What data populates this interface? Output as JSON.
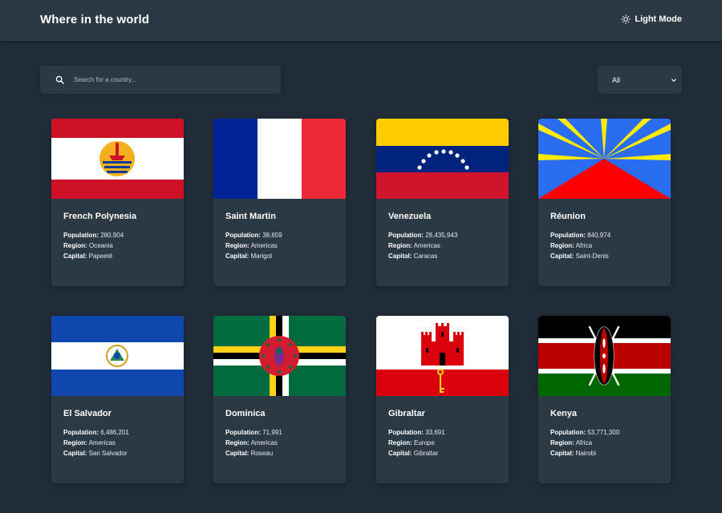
{
  "header": {
    "title": "Where in the world",
    "theme_label": "Light Mode"
  },
  "search": {
    "placeholder": "Search for a country..."
  },
  "filter": {
    "selected": "All"
  },
  "labels": {
    "population": "Population:",
    "region": "Region:",
    "capital": "Capital:"
  },
  "countries": [
    {
      "name": "French Polynesia",
      "population": "280,904",
      "region": "Oceania",
      "capital": "Papeeté"
    },
    {
      "name": "Saint Martin",
      "population": "38,659",
      "region": "Americas",
      "capital": "Marigot"
    },
    {
      "name": "Venezuela",
      "population": "28,435,943",
      "region": "Americas",
      "capital": "Caracas"
    },
    {
      "name": "Réunion",
      "population": "840,974",
      "region": "Africa",
      "capital": "Saint-Denis"
    },
    {
      "name": "El Salvador",
      "population": "6,486,201",
      "region": "Americas",
      "capital": "San Salvador"
    },
    {
      "name": "Dominica",
      "population": "71,991",
      "region": "Americas",
      "capital": "Roseau"
    },
    {
      "name": "Gibraltar",
      "population": "33,691",
      "region": "Europe",
      "capital": "Gibraltar"
    },
    {
      "name": "Kenya",
      "population": "53,771,300",
      "region": "Africa",
      "capital": "Nairobi"
    }
  ],
  "colors": {
    "background": "#202c37",
    "element": "#2b3945",
    "text": "#ffffff"
  }
}
